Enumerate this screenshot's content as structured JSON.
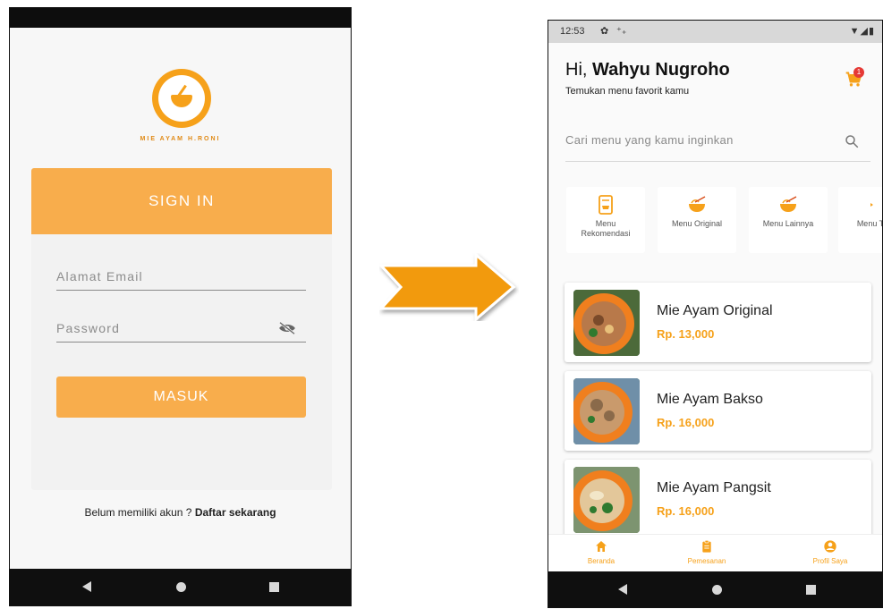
{
  "login": {
    "brand": "MIE AYAM H.RONI",
    "header": "SIGN IN",
    "email_placeholder": "Alamat Email",
    "password_placeholder": "Password",
    "submit_label": "MASUK",
    "signup_prompt": "Belum memiliki akun ?",
    "signup_link": "Daftar sekarang"
  },
  "home": {
    "status": {
      "time": "12:53",
      "gear": "✿",
      "net": "⁺₊"
    },
    "greeting_prefix": "Hi, ",
    "user_name": "Wahyu Nugroho",
    "subtitle": "Temukan menu favorit kamu",
    "cart_badge": "1",
    "search_placeholder": "Cari menu yang kamu inginkan",
    "categories": [
      {
        "label_line1": "Menu",
        "label_line2": "Rekomendasi",
        "icon": "recommendation-icon"
      },
      {
        "label_line1": "Menu Original",
        "label_line2": "",
        "icon": "noodle-bowl-icon"
      },
      {
        "label_line1": "Menu Lainnya",
        "label_line2": "",
        "icon": "noodle-bowl-icon"
      },
      {
        "label_line1": "Menu T",
        "label_line2": "",
        "icon": "menu-icon"
      }
    ],
    "items": [
      {
        "name": "Mie Ayam Original",
        "price": "Rp. 13,000"
      },
      {
        "name": "Mie Ayam Bakso",
        "price": "Rp. 16,000"
      },
      {
        "name": "Mie Ayam Pangsit",
        "price": "Rp. 16,000"
      }
    ],
    "bottom_nav": [
      {
        "label": "Beranda",
        "icon": "home-icon"
      },
      {
        "label": "Pemesanan",
        "icon": "clipboard-icon"
      },
      {
        "label": "Profil Saya",
        "icon": "account-icon"
      }
    ]
  },
  "colors": {
    "accent": "#f8ad4c",
    "arrow": "#f29a0e",
    "price": "#f6a11a",
    "badge": "#e53935"
  }
}
